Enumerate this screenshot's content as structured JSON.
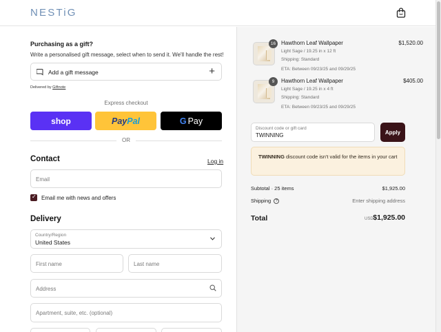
{
  "header": {
    "logo": "NESTiG",
    "cart_icon": "shopping-bag-icon"
  },
  "gift": {
    "title": "Purchasing as a gift?",
    "description": "Write a personalised gift message, select when to send it. We'll handle the rest!",
    "add_label": "Add a gift message",
    "delivered_prefix": "Delivered by",
    "delivered_link": "Giftnote"
  },
  "express": {
    "label": "Express checkout",
    "shop_label": "shop",
    "paypal_part1": "Pay",
    "paypal_part2": "Pal",
    "gpay_g": "G",
    "gpay_label": "Pay",
    "or_label": "OR"
  },
  "contact": {
    "title": "Contact",
    "login_label": "Log in",
    "email_placeholder": "Email",
    "newsletter_label": "Email me with news and offers",
    "newsletter_checked": true
  },
  "delivery": {
    "title": "Delivery",
    "country_label": "Country/Region",
    "country_value": "United States",
    "first_name_placeholder": "First name",
    "last_name_placeholder": "Last name",
    "address_placeholder": "Address",
    "apartment_placeholder": "Apartment, suite, etc. (optional)"
  },
  "order": {
    "items": [
      {
        "qty": "16",
        "name": "Hawthorn Leaf Wallpaper",
        "variant": "Light Sage / 19.25 in x 12 ft",
        "shipping": "Shipping: Standard",
        "eta": "ETA: Between 09/23/25 and 09/29/25",
        "price": "$1,520.00"
      },
      {
        "qty": "9",
        "name": "Hawthorn Leaf Wallpaper",
        "variant": "Light Sage / 19.25 in x 4 ft",
        "shipping": "Shipping: Standard",
        "eta": "ETA: Between 09/23/25 and 09/29/25",
        "price": "$405.00"
      }
    ],
    "discount_label": "Discount code or gift card",
    "discount_value": "TWINNING",
    "apply_label": "Apply",
    "alert_code": "TWINNING",
    "alert_text": " discount code isn't valid for the items in your cart",
    "subtotal_label": "Subtotal · 25 items",
    "subtotal_value": "$1,925.00",
    "shipping_label": "Shipping",
    "shipping_value": "Enter shipping address",
    "total_label": "Total",
    "total_currency": "USD",
    "total_value": "$1,925.00"
  },
  "colors": {
    "brand": "#6f8fb5",
    "accent": "#3a1318",
    "shop": "#5a31f4",
    "paypal": "#ffc439",
    "alert_bg": "#fbf1df"
  }
}
